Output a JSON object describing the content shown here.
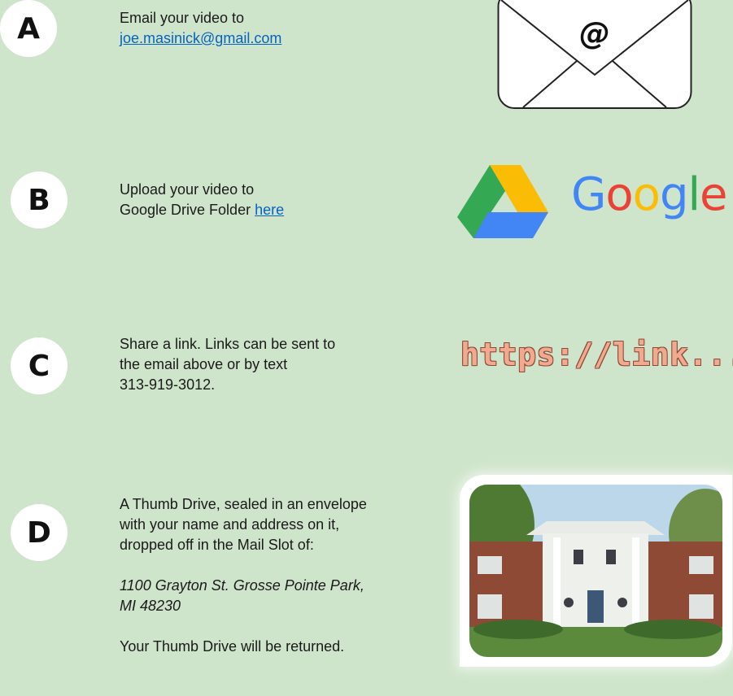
{
  "options": [
    {
      "letter": "A",
      "lines": [
        "Email your video to"
      ],
      "link": "joe.masinick@gmail.com",
      "icon": "envelope-at-icon"
    },
    {
      "letter": "B",
      "line1": "Upload your video to",
      "line2_prefix": "Google Drive Folder ",
      "link": "here",
      "logo_text": "Google"
    },
    {
      "letter": "C",
      "lines": [
        "Share a link. Links can be sent to",
        "the email above or by text",
        "313-919-3012."
      ],
      "graphic_text": "https://link..."
    },
    {
      "letter": "D",
      "lines": [
        "A Thumb Drive, sealed in an envelope",
        "with your name and address on it,",
        "dropped off in the Mail Slot of:"
      ],
      "address_lines": [
        "1100 Grayton St. Grosse Pointe Park,",
        "MI 48230"
      ],
      "footer": "Your Thumb Drive will be returned."
    }
  ],
  "colors": {
    "background": "#cfe5cb",
    "link": "#0563c1",
    "google_blue": "#4285f4",
    "google_red": "#ea4335",
    "google_yellow": "#fbbc05",
    "google_green": "#34a853"
  }
}
